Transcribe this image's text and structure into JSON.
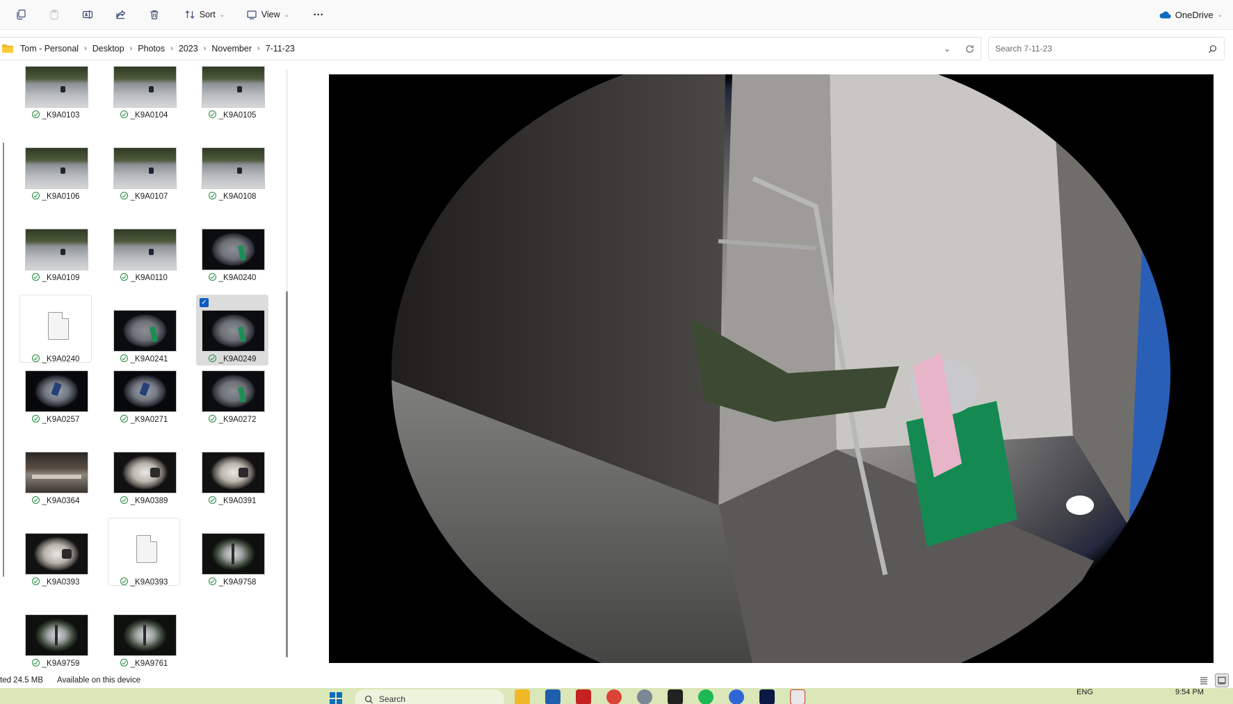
{
  "toolbar": {
    "sort_label": "Sort",
    "view_label": "View",
    "more_label": "···",
    "onedrive_label": "OneDrive",
    "onedrive_color": "#0f6cbd"
  },
  "breadcrumb": [
    "Tom - Personal",
    "Desktop",
    "Photos",
    "2023",
    "November",
    "7-11-23"
  ],
  "search": {
    "placeholder": "Search 7-11-23"
  },
  "files": [
    {
      "name": "_K9A0103",
      "kind": "street",
      "synced": true
    },
    {
      "name": "_K9A0104",
      "kind": "street",
      "synced": true
    },
    {
      "name": "_K9A0105",
      "kind": "street",
      "synced": true
    },
    {
      "name": "_K9A0106",
      "kind": "street",
      "synced": true
    },
    {
      "name": "_K9A0107",
      "kind": "street",
      "synced": true
    },
    {
      "name": "_K9A0108",
      "kind": "street",
      "synced": true
    },
    {
      "name": "_K9A0109",
      "kind": "street",
      "synced": true
    },
    {
      "name": "_K9A0110",
      "kind": "street",
      "synced": true
    },
    {
      "name": "_K9A0240",
      "kind": "fish",
      "synced": true
    },
    {
      "name": "_K9A0240",
      "kind": "doc",
      "synced": true
    },
    {
      "name": "_K9A0241",
      "kind": "fish",
      "synced": true
    },
    {
      "name": "_K9A0249",
      "kind": "fish",
      "synced": true,
      "selected": true
    },
    {
      "name": "_K9A0257",
      "kind": "fishwide",
      "synced": true
    },
    {
      "name": "_K9A0271",
      "kind": "fishwide",
      "synced": true
    },
    {
      "name": "_K9A0272",
      "kind": "fish",
      "synced": true
    },
    {
      "name": "_K9A0364",
      "kind": "dark",
      "synced": true
    },
    {
      "name": "_K9A0389",
      "kind": "stairs",
      "synced": true
    },
    {
      "name": "_K9A0391",
      "kind": "stairs",
      "synced": true
    },
    {
      "name": "_K9A0393",
      "kind": "stairs",
      "synced": true
    },
    {
      "name": "_K9A0393",
      "kind": "doc",
      "synced": true
    },
    {
      "name": "_K9A9758",
      "kind": "trees",
      "synced": true
    },
    {
      "name": "_K9A9759",
      "kind": "trees",
      "synced": true
    },
    {
      "name": "_K9A9761",
      "kind": "trees",
      "synced": true
    }
  ],
  "status": {
    "size_text": "ted  24.5 MB",
    "availability": "Available on this device"
  },
  "taskbar": {
    "search_placeholder": "Search",
    "language": "ENG",
    "time": "9:54 PM"
  },
  "colors": {
    "selection_check": "#0b5cc2",
    "sync_green": "#1f8a3b",
    "taskbar_bg": "#dbe7b9"
  }
}
